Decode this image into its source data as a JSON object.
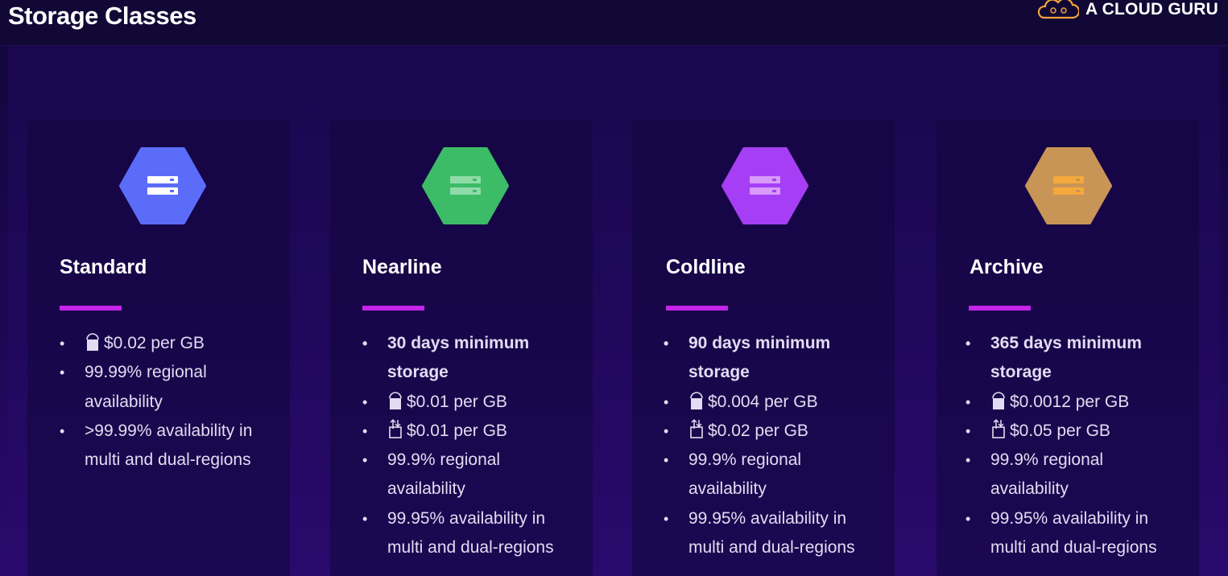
{
  "header": {
    "title": "Storage Classes",
    "brand": "A CLOUD GURU"
  },
  "colors": {
    "standard": "#5b6cf9",
    "nearline": "#3cbc67",
    "coldline": "#a53ef4",
    "archive": "#c99556",
    "accent": "#c425e8"
  },
  "classes": [
    {
      "name": "Standard",
      "bullets": [
        {
          "text": "$0.02 per GB",
          "icon": "storage-bucket-icon"
        },
        {
          "text": "99.99% regional availability"
        },
        {
          "text": ">99.99% availability in multi and dual-regions"
        }
      ]
    },
    {
      "name": "Nearline",
      "bullets": [
        {
          "text": "30 days minimum storage",
          "bold": true
        },
        {
          "text": "$0.01 per GB",
          "icon": "storage-bucket-icon"
        },
        {
          "text": "$0.01 per GB",
          "icon": "retrieval-icon"
        },
        {
          "text": "99.9% regional availability"
        },
        {
          "text": "99.95% availability in multi and dual-regions"
        }
      ]
    },
    {
      "name": "Coldline",
      "bullets": [
        {
          "text": "90 days minimum storage",
          "bold": true
        },
        {
          "text": "$0.004 per GB",
          "icon": "storage-bucket-icon"
        },
        {
          "text": "$0.02 per GB",
          "icon": "retrieval-icon"
        },
        {
          "text": "99.9% regional availability"
        },
        {
          "text": "99.95% availability in multi and dual-regions"
        }
      ]
    },
    {
      "name": "Archive",
      "bullets": [
        {
          "text": "365 days minimum storage",
          "bold": true
        },
        {
          "text": "$0.0012 per GB",
          "icon": "storage-bucket-icon"
        },
        {
          "text": "$0.05 per GB",
          "icon": "retrieval-icon"
        },
        {
          "text": "99.9% regional availability"
        },
        {
          "text": "99.95% availability in multi and dual-regions"
        }
      ]
    }
  ]
}
